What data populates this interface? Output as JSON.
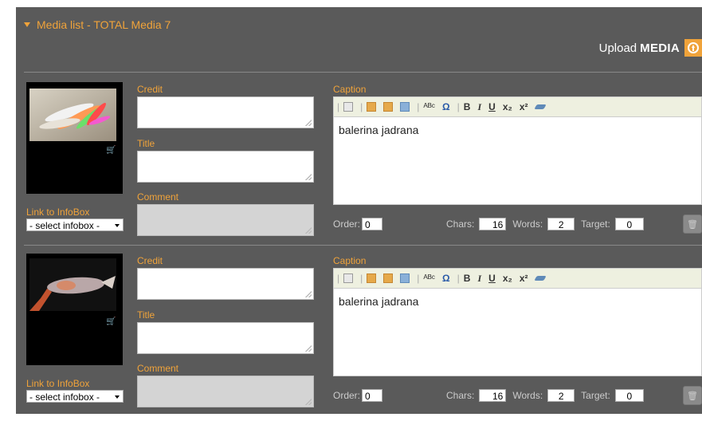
{
  "header": {
    "title": "Media list - TOTAL Media 7",
    "upload_label": "Upload",
    "upload_bold": "MEDIA"
  },
  "labels": {
    "credit": "Credit",
    "title": "Title",
    "comment": "Comment",
    "caption": "Caption",
    "link_to_infobox": "Link to InfoBox",
    "order": "Order:",
    "chars": "Chars:",
    "words": "Words:",
    "target": "Target:"
  },
  "toolbar": {
    "bold": "B",
    "italic": "I",
    "underline": "U",
    "subscript": "x₂",
    "superscript": "x²"
  },
  "items": [
    {
      "caption_text": "balerina jadrana",
      "infobox_select": "- select infobox -",
      "order": "0",
      "chars": "16",
      "words": "2",
      "target": "0"
    },
    {
      "caption_text": "balerina jadrana",
      "infobox_select": "- select infobox -",
      "order": "0",
      "chars": "16",
      "words": "2",
      "target": "0"
    }
  ],
  "colors": {
    "accent": "#f0a33a",
    "panel": "#5a5a5a"
  }
}
